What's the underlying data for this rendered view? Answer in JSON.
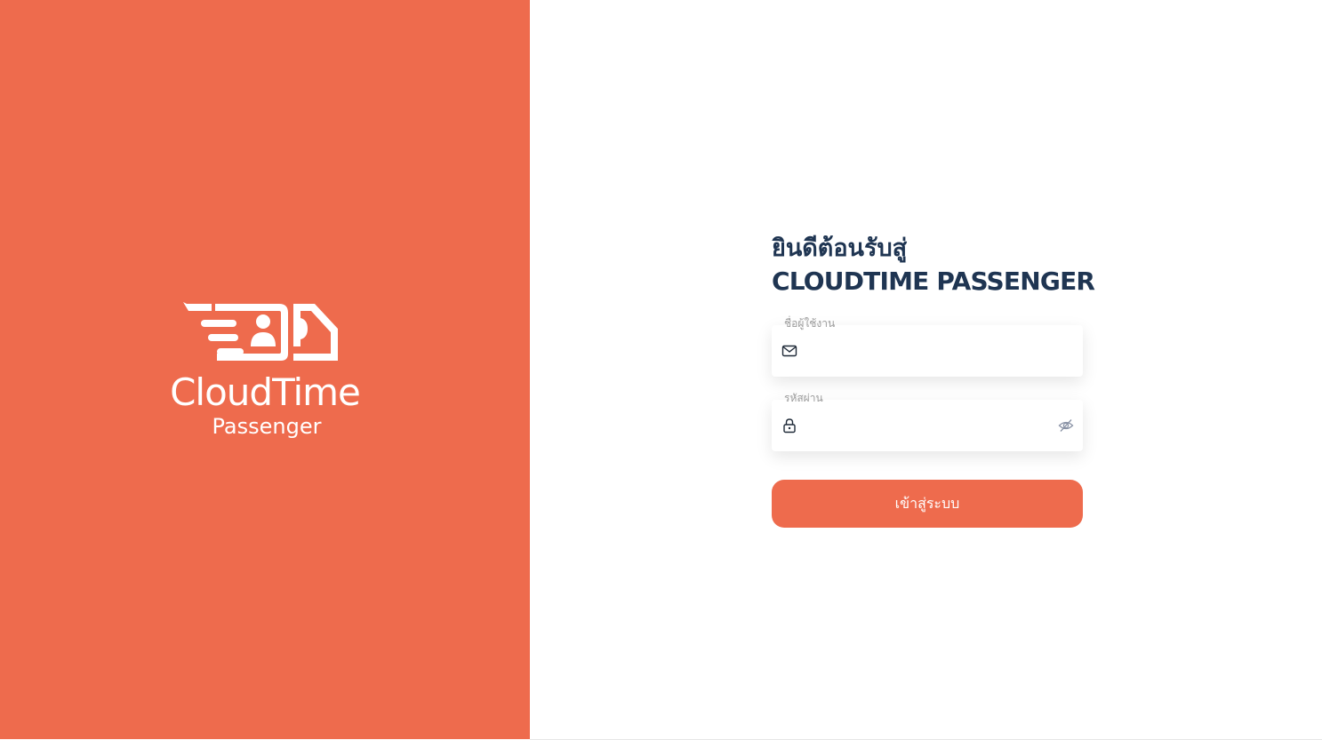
{
  "brand": {
    "name": "CloudTime",
    "subtitle": "Passenger",
    "panel_color": "#ee6b4d",
    "logo_icon": "id-card-speed-icon"
  },
  "login": {
    "welcome": "ยินดีต้อนรับสู่",
    "app_title": "CLOUDTIME PASSENGER",
    "username": {
      "label": "ชื่อผู้ใช้งาน",
      "value": "",
      "icon": "mail-icon"
    },
    "password": {
      "label": "รหัสผ่าน",
      "value": "",
      "icon": "lock-icon",
      "toggle_icon": "eye-off-icon"
    },
    "submit_label": "เข้าสู่ระบบ"
  },
  "colors": {
    "accent": "#ee6b4d",
    "title": "#1f3552",
    "label": "#9b9b9b"
  }
}
